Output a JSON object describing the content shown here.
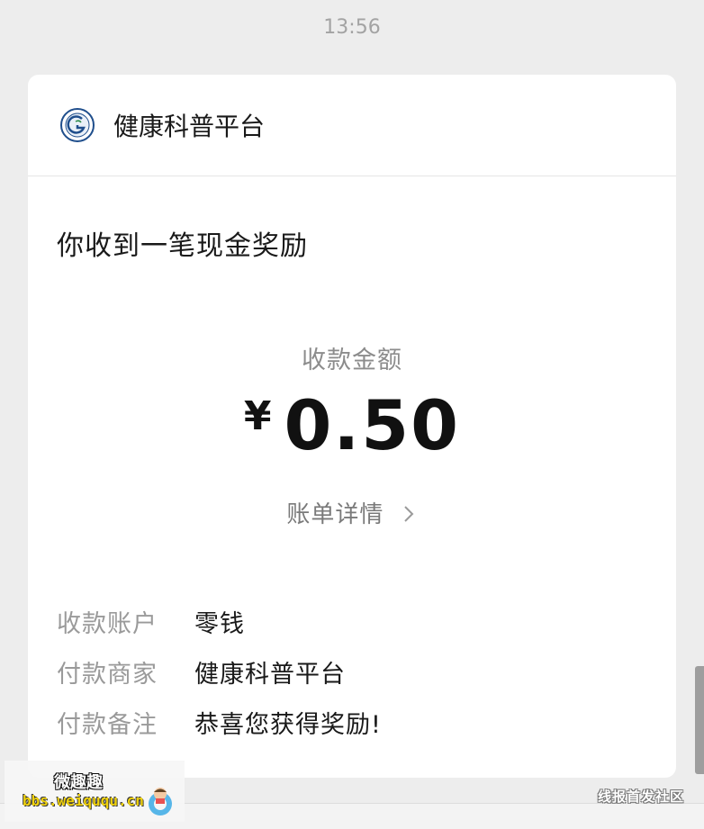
{
  "time": "13:56",
  "header": {
    "sender_name": "健康科普平台",
    "logo_icon": "health-platform-logo-icon"
  },
  "notice_title": "你收到一笔现金奖励",
  "amount_section": {
    "label": "收款金额",
    "currency": "¥",
    "value": "0.50",
    "details_link": "账单详情",
    "details_icon": "chevron-right-icon"
  },
  "info_rows": [
    {
      "label": "收款账户",
      "value": "零钱"
    },
    {
      "label": "付款商家",
      "value": "健康科普平台"
    },
    {
      "label": "付款备注",
      "value": "恭喜您获得奖励!"
    }
  ],
  "watermarks": {
    "left_cn": "微趣趣",
    "left_url": "bbs.weiququ.cn",
    "right_text": "线报首发社区"
  },
  "colors": {
    "background": "#ededed",
    "card": "#ffffff",
    "muted_text": "#9a9a9a",
    "primary_text": "#191919"
  }
}
